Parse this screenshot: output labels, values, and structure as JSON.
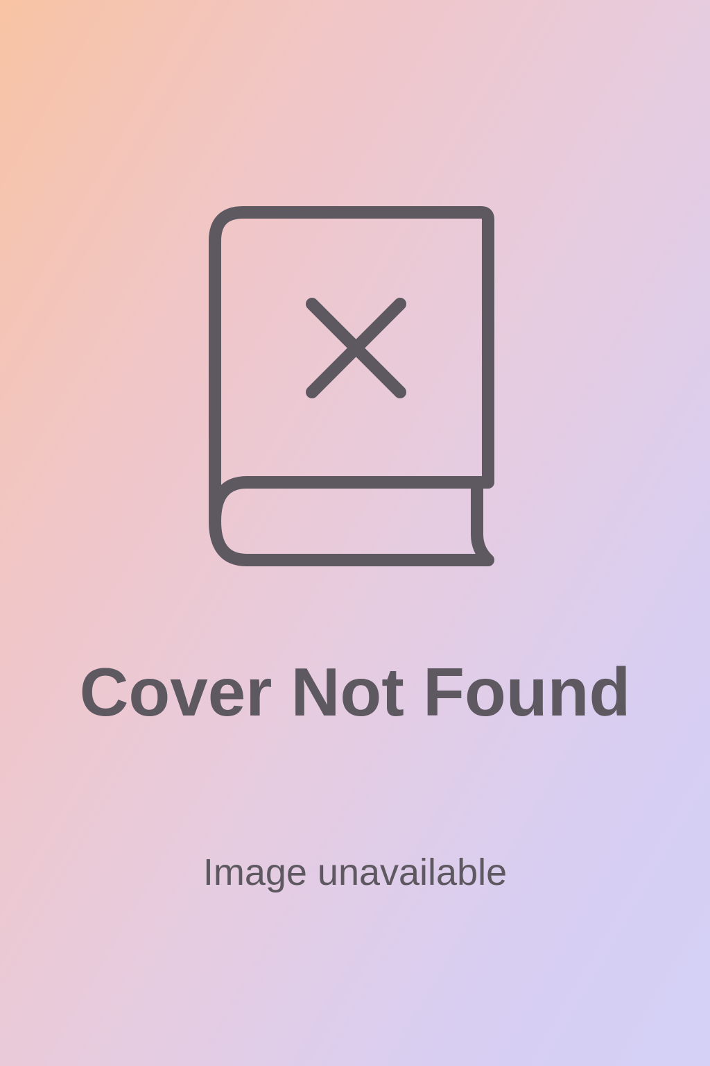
{
  "placeholder": {
    "icon": "book-with-x-icon",
    "title": "Cover Not Found",
    "subtitle": "Image unavailable"
  },
  "colors": {
    "foreground": "#5e5860",
    "gradient_start": "#f8c4a4",
    "gradient_end": "#d4d0f6"
  }
}
